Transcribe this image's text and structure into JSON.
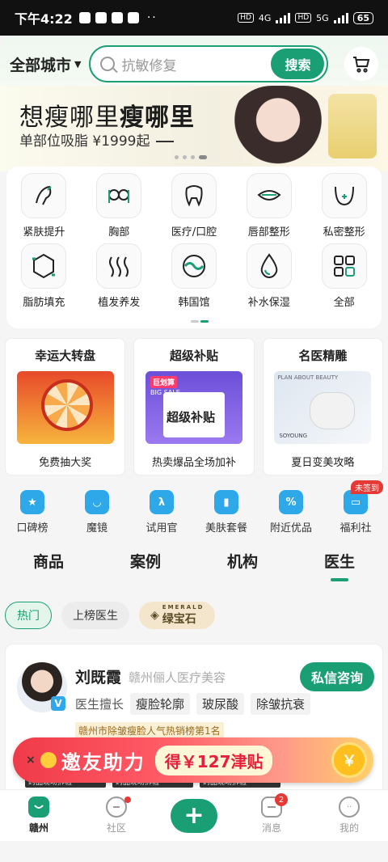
{
  "status": {
    "time": "下午4:22",
    "hd1": "HD",
    "net1": "4G",
    "hd2": "HD",
    "net2": "5G",
    "battery": "65"
  },
  "search": {
    "city": "全部城市",
    "placeholder": "抗敏修复",
    "button": "搜索"
  },
  "banner": {
    "title_a": "想瘦哪里",
    "title_b": "瘦哪里",
    "subtitle": "单部位吸脂 ¥1999起"
  },
  "categories": [
    {
      "label": "紧肤提升",
      "icon": "face-lift-icon"
    },
    {
      "label": "胸部",
      "icon": "chest-icon"
    },
    {
      "label": "医疗/口腔",
      "icon": "tooth-icon"
    },
    {
      "label": "唇部整形",
      "icon": "lips-icon"
    },
    {
      "label": "私密整形",
      "icon": "private-icon"
    },
    {
      "label": "脂肪填充",
      "icon": "fat-fill-icon"
    },
    {
      "label": "植发养发",
      "icon": "hair-icon"
    },
    {
      "label": "韩国馆",
      "icon": "korea-icon"
    },
    {
      "label": "补水保湿",
      "icon": "water-drop-icon"
    },
    {
      "label": "全部",
      "icon": "grid-icon"
    }
  ],
  "promos": [
    {
      "title": "幸运大转盘",
      "desc": "免费抽大奖"
    },
    {
      "title": "超级补贴",
      "desc": "热卖爆品全场加补",
      "img_tag_top": "巨划算",
      "img_tag_bottom": "BIG SALE",
      "img_text": "超级补贴"
    },
    {
      "title": "名医精雕",
      "desc": "夏日变美攻略",
      "img_text_top": "PLAN ABOUT BEAUTY",
      "img_text_bottom": "SOYOUNG"
    }
  ],
  "shortcuts": [
    {
      "label": "口碑榜",
      "icon": "trophy-icon",
      "glyph": "★"
    },
    {
      "label": "魔镜",
      "icon": "mirror-icon",
      "glyph": "◡"
    },
    {
      "label": "试用官",
      "icon": "trial-icon",
      "glyph": "λ"
    },
    {
      "label": "美肤套餐",
      "icon": "package-icon",
      "glyph": "▮"
    },
    {
      "label": "附近优品",
      "icon": "nearby-icon",
      "glyph": "%"
    },
    {
      "label": "福利社",
      "icon": "welfare-icon",
      "glyph": "▭",
      "badge": "未签到"
    }
  ],
  "tabs": [
    "商品",
    "案例",
    "机构",
    "医生"
  ],
  "active_tab": 3,
  "chips": {
    "hot": "热门",
    "ranked": "上榜医生",
    "emerald_top": "EMERALD",
    "emerald": "绿宝石"
  },
  "doctor": {
    "name": "刘既霞",
    "institution": "赣州俪人医疗美容",
    "consult": "私信咨询",
    "skill_label": "医生擅长",
    "skills": [
      "瘦脸轮廓",
      "玻尿酸",
      "除皱抗衰"
    ],
    "rank": "赣州市除皱瘦脸人气热销榜第1名",
    "thumb_tag": "药品现场拆验"
  },
  "invite": {
    "close": "×",
    "text": "邀友助力",
    "amount": "得￥127津贴",
    "coin": "￥"
  },
  "nav": [
    {
      "label": "赣州",
      "icon": "home-icon"
    },
    {
      "label": "社区",
      "icon": "community-icon"
    },
    {
      "label": "",
      "icon": "plus-icon"
    },
    {
      "label": "消息",
      "icon": "message-icon",
      "badge": "2"
    },
    {
      "label": "我的",
      "icon": "profile-icon"
    }
  ],
  "colors": {
    "accent": "#1a9e73",
    "badge": "#e53935",
    "shortcut_blue": "#2ea8e8"
  }
}
